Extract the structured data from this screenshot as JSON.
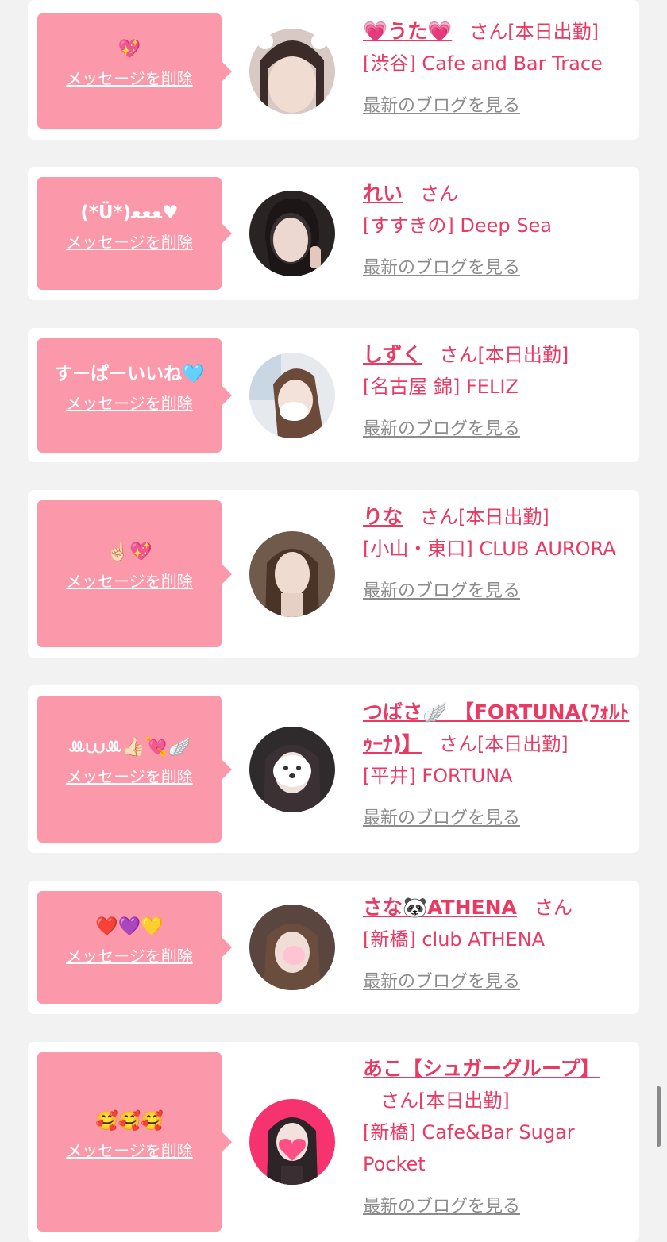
{
  "delete_label": "メッセージを削除",
  "blog_label": "最新のブログを見る",
  "cards": [
    {
      "message": "💖",
      "name": "💗うた💗",
      "honorific": "さん",
      "status": "[本日出勤]",
      "shop": "[渋谷] Cafe and Bar Trace"
    },
    {
      "message": "(*Ü*)ﻌﻌﻌ♥",
      "name": "れい",
      "honorific": "さん",
      "status": "",
      "shop": "[すすきの] Deep Sea"
    },
    {
      "message": "すーぱーいいね🩵",
      "name": "しずく",
      "honorific": "さん",
      "status": "[本日出勤]",
      "shop": "[名古屋 錦] FELIZ"
    },
    {
      "message": "☝🏻💖",
      "name": "りな",
      "honorific": "さん",
      "status": "[本日出勤]",
      "shop": "[小山・東口] CLUB AURORA"
    },
    {
      "message": "ꔛ⩊ꔛ👍🏻💘🪽",
      "name": "つばさ🪽 【FORTUNA(ﾌｫﾙﾄｩｰﾅ)】",
      "honorific": "さん",
      "status": "[本日出勤]",
      "shop": "[平井] FORTUNA"
    },
    {
      "message": "❤️💜💛",
      "name": "さな🐼ATHENA",
      "honorific": "さん",
      "status": "",
      "shop": "[新橋] club ATHENA"
    },
    {
      "message": "🥰🥰🥰",
      "name": "あこ【シュガーグループ】",
      "honorific": "さん",
      "status": "[本日出勤]",
      "shop": "[新橋] Cafe&Bar Sugar Pocket"
    }
  ],
  "colors": {
    "background": "#f2f2f2",
    "card": "#ffffff",
    "bubble": "#fb98aa",
    "accent": "#e83a63",
    "link_gray": "#8c8c8c"
  }
}
